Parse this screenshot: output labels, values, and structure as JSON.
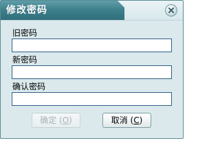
{
  "dialog": {
    "title": "修改密码",
    "close_icon": "close-icon",
    "colors": {
      "title_bar": "#3d7f8b",
      "body": "#dbe9ec",
      "input_border": "#2f5f8a"
    }
  },
  "fields": {
    "old_password": {
      "label": "旧密码",
      "value": ""
    },
    "new_password": {
      "label": "新密码",
      "value": ""
    },
    "confirm_password": {
      "label": "确认密码",
      "value": ""
    }
  },
  "buttons": {
    "ok": {
      "label": "确定",
      "accel_open": "(",
      "accel": "O",
      "accel_close": ")",
      "enabled": false
    },
    "cancel": {
      "label": "取消",
      "accel_open": "(",
      "accel": "C",
      "accel_close": ")",
      "enabled": true
    }
  }
}
